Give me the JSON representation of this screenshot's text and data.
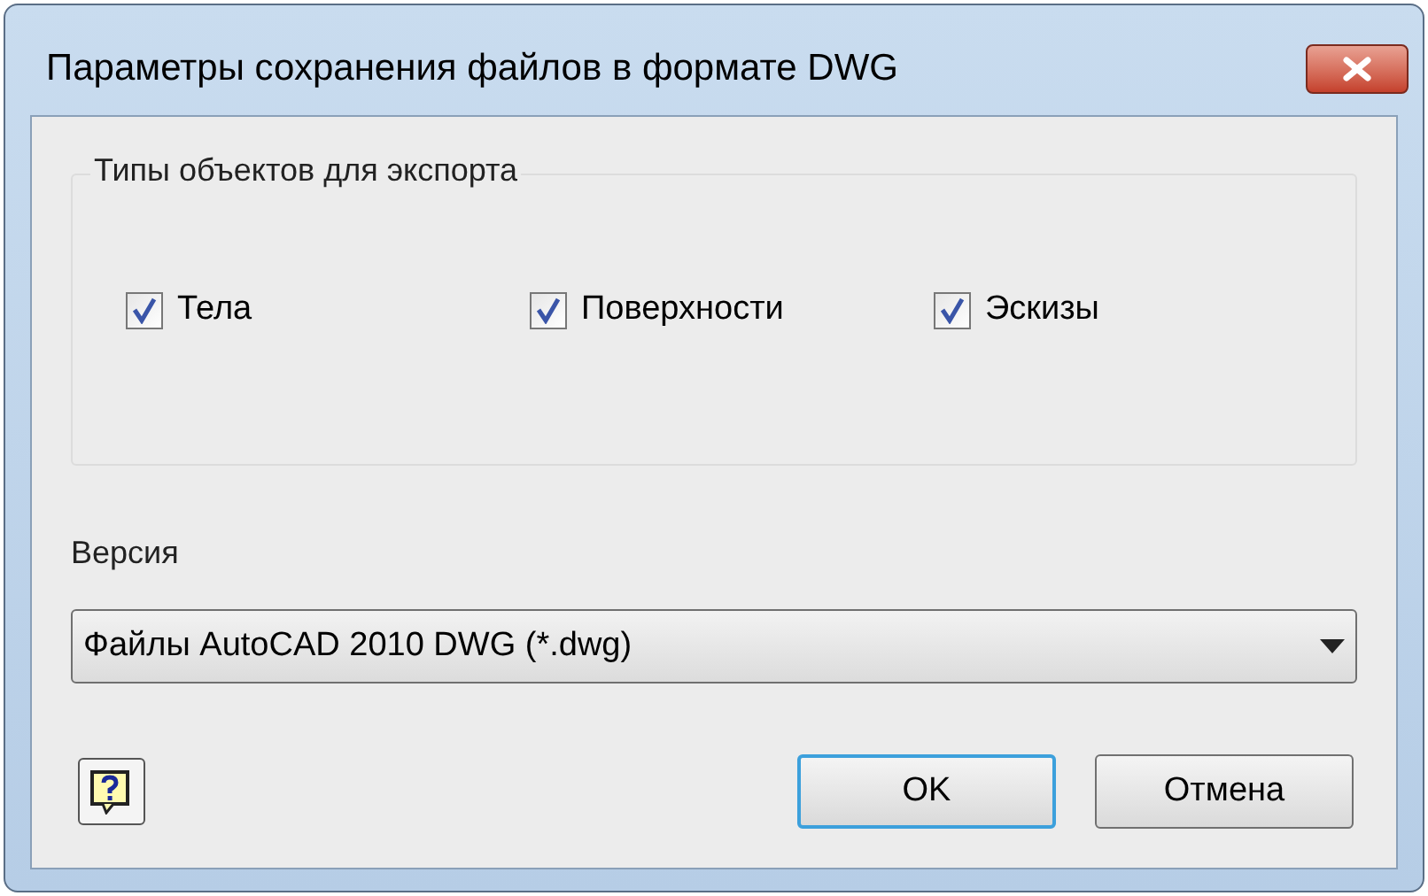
{
  "window": {
    "title": "Параметры сохранения файлов в формате DWG"
  },
  "group": {
    "title": "Типы объектов для экспорта",
    "options": [
      {
        "label": "Тела",
        "checked": true
      },
      {
        "label": "Поверхности",
        "checked": true
      },
      {
        "label": "Эскизы",
        "checked": true
      }
    ]
  },
  "version": {
    "label": "Версия",
    "value": "Файлы AutoCAD 2010 DWG (*.dwg)"
  },
  "buttons": [
    {
      "label": "OK",
      "default": true
    },
    {
      "label": "Отмена",
      "default": false
    }
  ]
}
